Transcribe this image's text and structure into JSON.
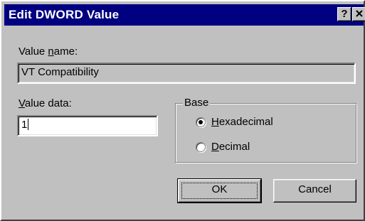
{
  "window": {
    "title": "Edit DWORD Value",
    "help_button": "?",
    "close_icon": "close-icon"
  },
  "value_name": {
    "label": "Value name:",
    "accelerator": "n",
    "value": "VT Compatibility"
  },
  "value_data": {
    "label": "Value data:",
    "accelerator": "V",
    "value": "1"
  },
  "base": {
    "label": "Base",
    "options": [
      {
        "label": "Hexadecimal",
        "accelerator": "H",
        "selected": true
      },
      {
        "label": "Decimal",
        "accelerator": "D",
        "selected": false
      }
    ]
  },
  "buttons": {
    "ok": "OK",
    "cancel": "Cancel"
  },
  "colors": {
    "titlebar": "#000080",
    "face": "#c0c0c0"
  }
}
